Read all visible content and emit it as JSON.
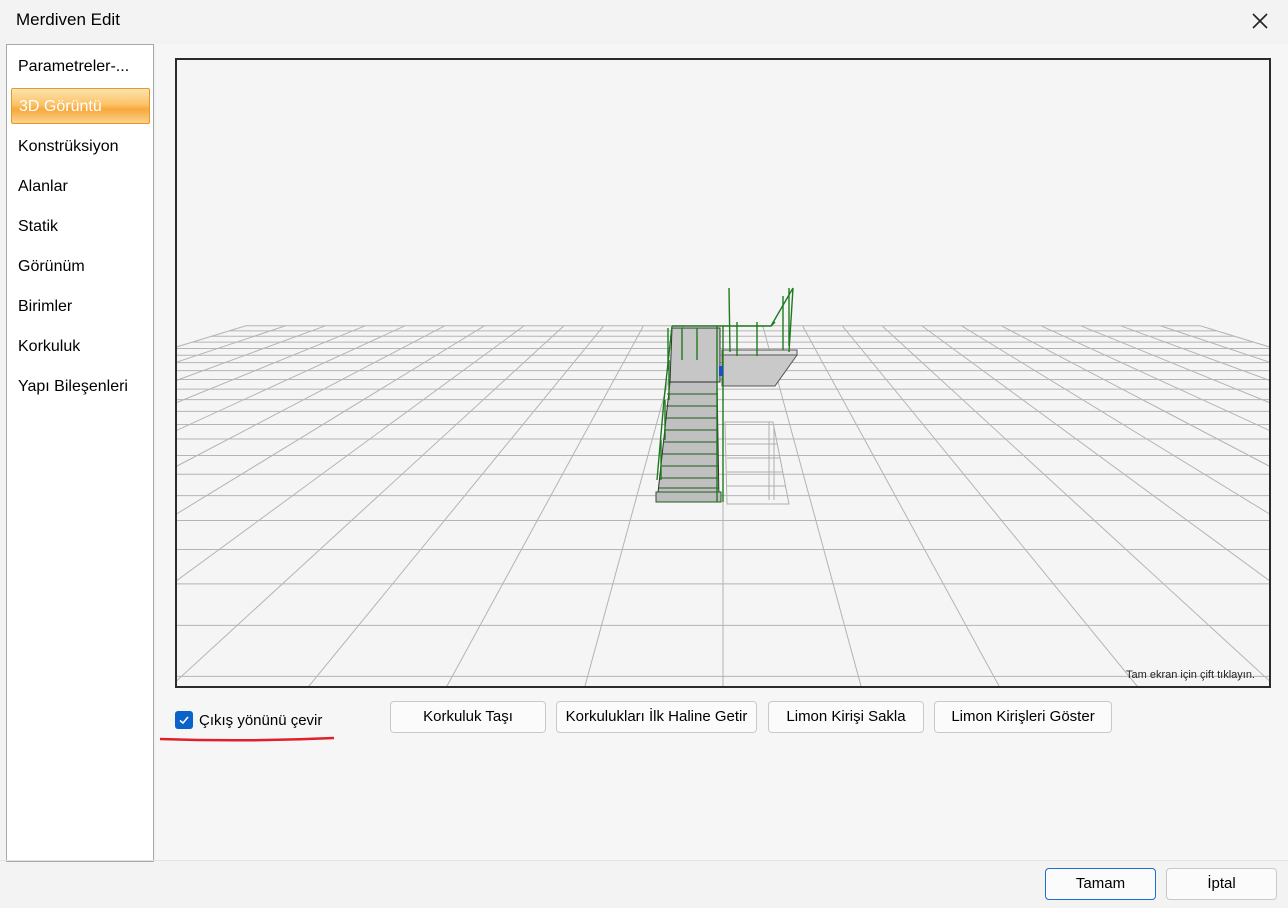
{
  "window": {
    "title": "Merdiven Edit"
  },
  "sidebar": {
    "items": [
      {
        "label": "Parametreler-..."
      },
      {
        "label": "3D Görüntü",
        "active": true
      },
      {
        "label": "Konstrüksiyon"
      },
      {
        "label": "Alanlar"
      },
      {
        "label": "Statik"
      },
      {
        "label": "Görünüm"
      },
      {
        "label": "Birimler"
      },
      {
        "label": "Korkuluk"
      },
      {
        "label": "Yapı Bileşenleri"
      }
    ]
  },
  "viewport": {
    "hint": "Tam ekran için çift tıklayın."
  },
  "options": {
    "flip_exit_label": "Çıkış yönünü çevir",
    "flip_exit_checked": true
  },
  "buttons": {
    "move_railing": "Korkuluk Taşı",
    "reset_railings": "Korkulukları İlk Haline Getir",
    "hide_stringer": "Limon Kirişi Sakla",
    "show_stringers": "Limon Kirişleri Göster"
  },
  "footer": {
    "ok_label": "Tamam",
    "cancel_label": "İptal"
  },
  "colors": {
    "accent": "#0a63c9",
    "active_nav": "#f7a93c",
    "railing": "#1f7a1f",
    "annotation": "#e0202a"
  },
  "icons": {
    "close": "close-icon",
    "check": "check-icon"
  }
}
